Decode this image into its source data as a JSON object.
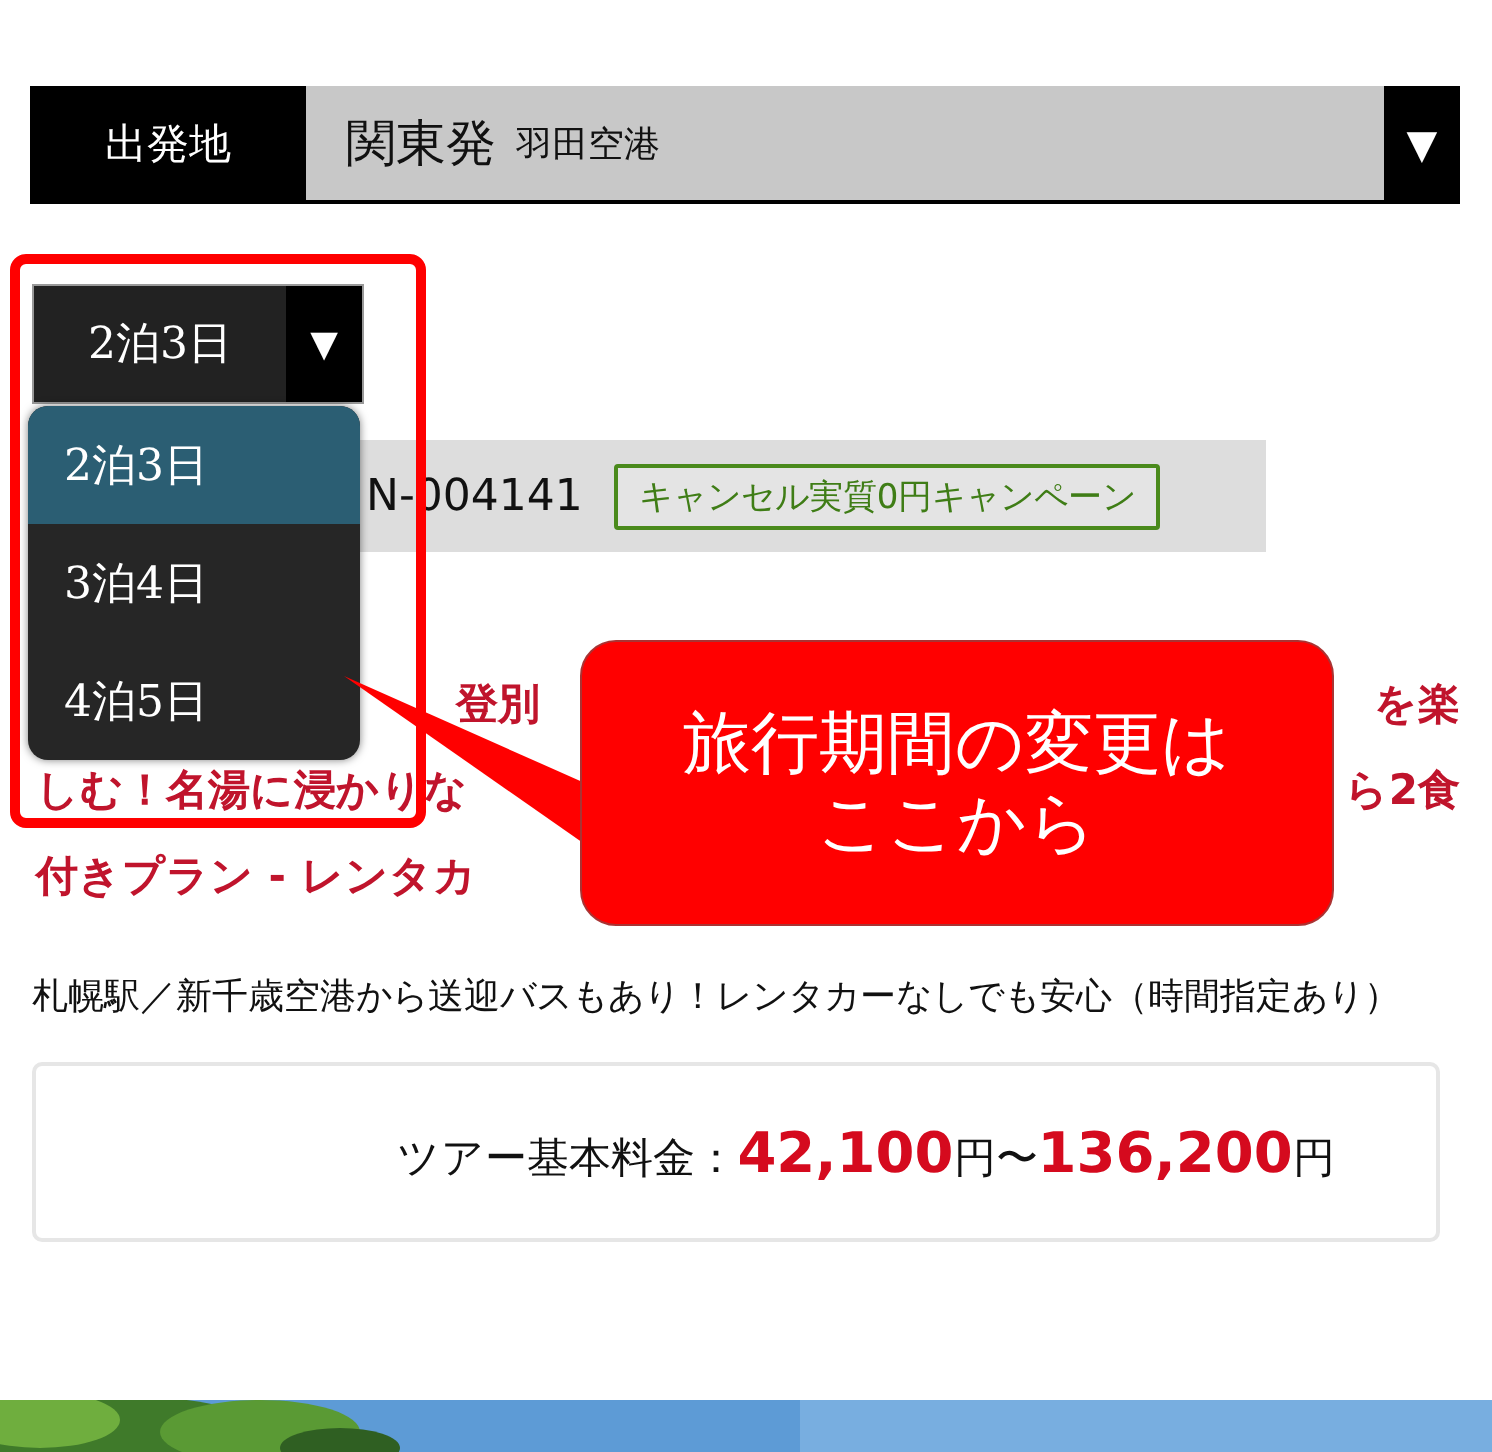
{
  "departure": {
    "label": "出発地",
    "region": "関東発",
    "airport": "羽田空港",
    "arrow": "▼"
  },
  "duration": {
    "value": "2泊3日",
    "arrow": "▼",
    "expanded": true,
    "options": [
      {
        "label": "2泊3日",
        "selected": true
      },
      {
        "label": "3泊4日",
        "selected": false
      },
      {
        "label": "4泊5日",
        "selected": false
      }
    ]
  },
  "plan": {
    "code": "N-004141",
    "badge": "キャンセル実質0円キャンペーン"
  },
  "title_lines": [
    {
      "left": "登別",
      "right": "を楽"
    },
    {
      "left": "しむ！名湯に浸かりな",
      "right": "ら2食"
    },
    {
      "left": "付きプラン - レンタカ"
    }
  ],
  "description": "札幌駅／新千歳空港から送迎バスもあり！レンタカーなしでも安心（時間指定あり）",
  "price": {
    "label": "ツアー基本料金：",
    "min": "42,100",
    "min_unit": "円",
    "separator": "〜",
    "max": "136,200",
    "max_unit": "円"
  },
  "callout": {
    "lines": [
      "旅行期間の変更は",
      "ここから"
    ]
  }
}
